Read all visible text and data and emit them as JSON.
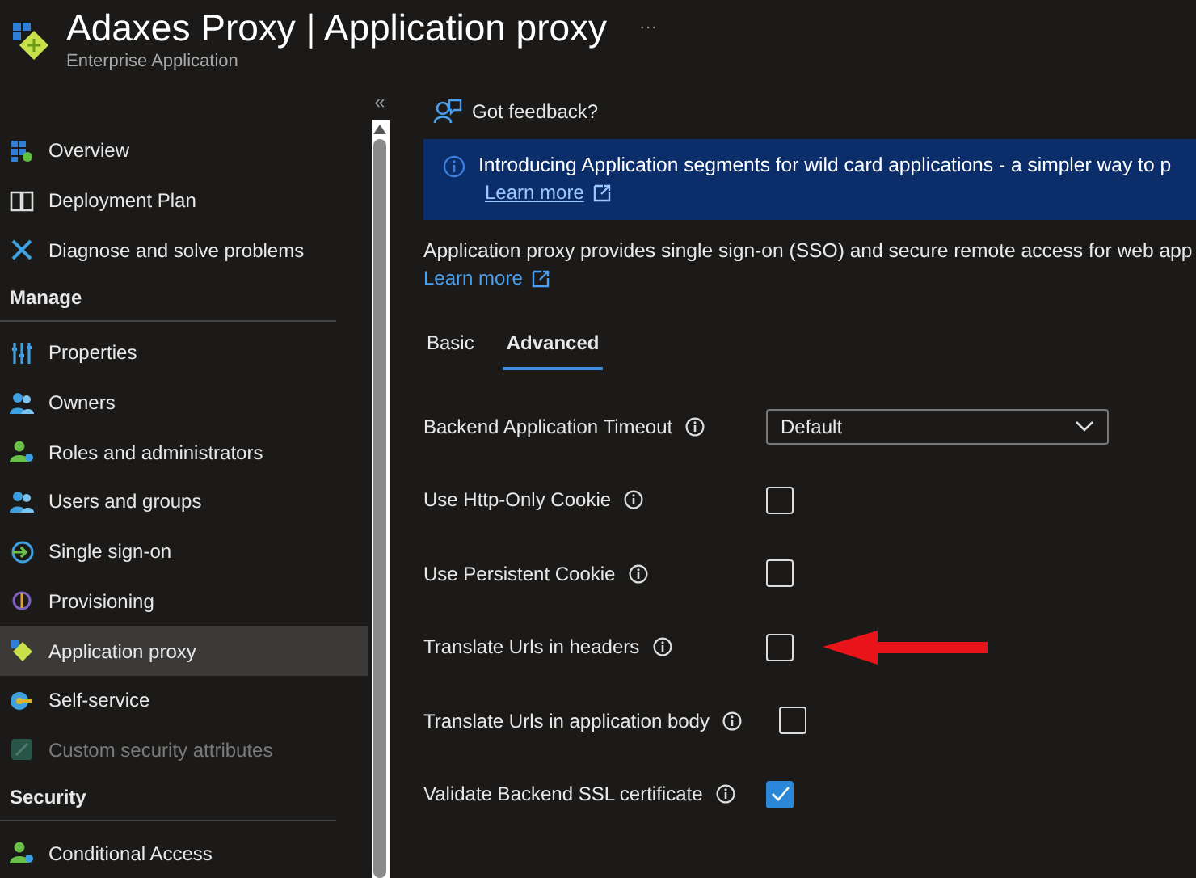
{
  "header": {
    "title": "Adaxes Proxy | Application proxy",
    "subtitle": "Enterprise Application",
    "more": "···"
  },
  "sidebar": {
    "collapse": "«",
    "groups": [
      {
        "items": [
          {
            "label": "Overview",
            "selected": false,
            "disabled": false
          },
          {
            "label": "Deployment Plan",
            "selected": false,
            "disabled": false
          },
          {
            "label": "Diagnose and solve problems",
            "selected": false,
            "disabled": false
          }
        ]
      },
      {
        "heading": "Manage",
        "items": [
          {
            "label": "Properties",
            "selected": false,
            "disabled": false
          },
          {
            "label": "Owners",
            "selected": false,
            "disabled": false
          },
          {
            "label": "Roles and administrators",
            "selected": false,
            "disabled": false
          },
          {
            "label": "Users and groups",
            "selected": false,
            "disabled": false
          },
          {
            "label": "Single sign-on",
            "selected": false,
            "disabled": false
          },
          {
            "label": "Provisioning",
            "selected": false,
            "disabled": false
          },
          {
            "label": "Application proxy",
            "selected": true,
            "disabled": false
          },
          {
            "label": "Self-service",
            "selected": false,
            "disabled": false
          },
          {
            "label": "Custom security attributes",
            "selected": false,
            "disabled": true
          }
        ]
      },
      {
        "heading": "Security",
        "items": [
          {
            "label": "Conditional Access",
            "selected": false,
            "disabled": false
          }
        ]
      }
    ]
  },
  "feedback": "Got feedback?",
  "banner": {
    "text": "Introducing Application segments for wild card applications - a simpler way to p",
    "link": "Learn more"
  },
  "description": {
    "text": "Application proxy provides single sign-on (SSO) and secure remote access for web app",
    "link": "Learn more"
  },
  "tabs": [
    {
      "label": "Basic",
      "selected": false
    },
    {
      "label": "Advanced",
      "selected": true
    }
  ],
  "settings": [
    {
      "kind": "dropdown",
      "label": "Backend Application Timeout",
      "value": "Default"
    },
    {
      "kind": "checkbox",
      "label": "Use Http-Only Cookie",
      "checked": false,
      "annotated": false
    },
    {
      "kind": "checkbox",
      "label": "Use Persistent Cookie",
      "checked": false,
      "annotated": false
    },
    {
      "kind": "checkbox",
      "label": "Translate Urls in headers",
      "checked": false,
      "annotated": true
    },
    {
      "kind": "checkbox",
      "label": "Translate Urls in application body",
      "checked": false,
      "annotated": false
    },
    {
      "kind": "checkbox",
      "label": "Validate Backend SSL certificate",
      "checked": true,
      "annotated": false
    }
  ]
}
